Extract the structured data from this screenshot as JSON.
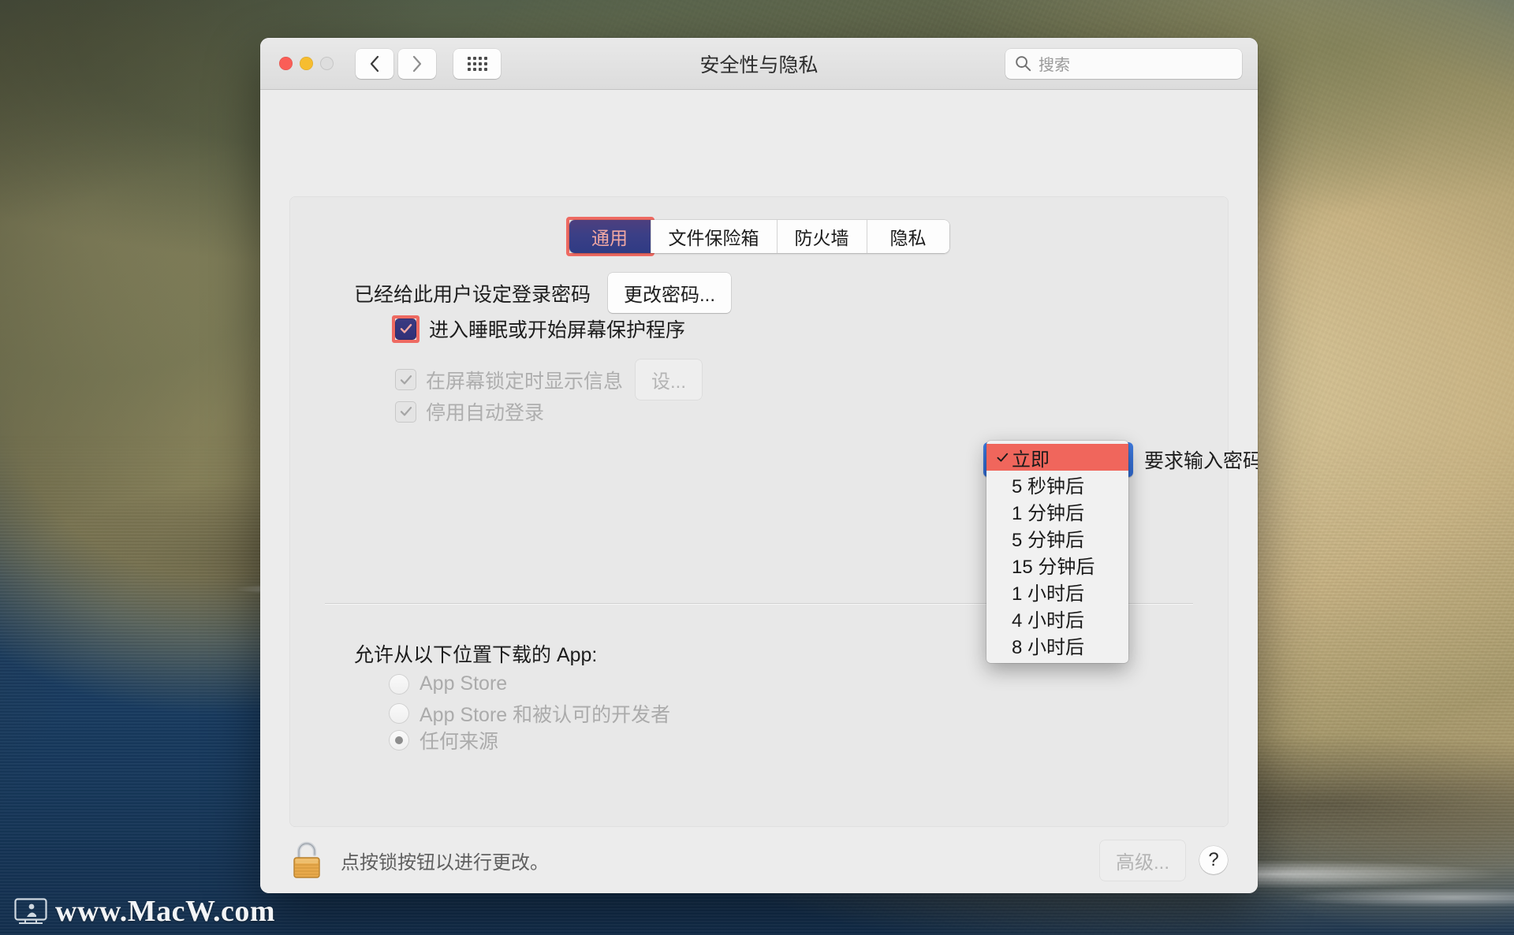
{
  "window": {
    "title": "安全性与隐私",
    "traffic_lights": [
      "close",
      "minimize",
      "zoom"
    ],
    "nav": {
      "back": "back-chevron",
      "forward": "forward-chevron",
      "grid": "show-all-grid"
    }
  },
  "search": {
    "placeholder": "搜索",
    "value": "",
    "icon": "search-icon"
  },
  "tabs": [
    {
      "label": "通用",
      "active": true
    },
    {
      "label": "文件保险箱",
      "active": false
    },
    {
      "label": "防火墙",
      "active": false
    },
    {
      "label": "隐私",
      "active": false
    }
  ],
  "general": {
    "password_row": {
      "label": "已经给此用户设定登录密码",
      "button": "更改密码..."
    },
    "checkboxes": [
      {
        "label": "进入睡眠或开始屏幕保护程序",
        "checked": true,
        "enabled": true,
        "highlighted": true
      },
      {
        "label": "在屏幕锁定时显示信息",
        "checked": true,
        "enabled": false,
        "button": "设..."
      },
      {
        "label": "停用自动登录",
        "checked": true,
        "enabled": false
      }
    ],
    "require_password_suffix": "要求输入密码",
    "popup_value": "立即",
    "dropdown_options": [
      {
        "label": "立即",
        "selected": true
      },
      {
        "label": "5 秒钟后",
        "selected": false
      },
      {
        "label": "1 分钟后",
        "selected": false
      },
      {
        "label": "5 分钟后",
        "selected": false
      },
      {
        "label": "15 分钟后",
        "selected": false
      },
      {
        "label": "1 小时后",
        "selected": false
      },
      {
        "label": "4 小时后",
        "selected": false
      },
      {
        "label": "8 小时后",
        "selected": false
      }
    ]
  },
  "downloads": {
    "title": "允许从以下位置下载的 App:",
    "options": [
      {
        "label": "App Store",
        "selected": false
      },
      {
        "label": "App Store 和被认可的开发者",
        "selected": false
      },
      {
        "label": "任何来源",
        "selected": true
      }
    ]
  },
  "bottom": {
    "lock_icon": "unlocked-padlock-icon",
    "lock_text": "点按锁按钮以进行更改。",
    "advanced_button": "高级...",
    "help_button": "?"
  },
  "watermark": {
    "text": "www.MacW.com",
    "icon": "monitor-icon"
  },
  "colors": {
    "accent_blue": "#2f6ad3",
    "highlight_red": "#ee6a62",
    "menu_selected": "#f0665c",
    "tab_active_start": "#4e3f7e",
    "tab_active_end": "#2f3b84",
    "tab_active_text": "#f3a9a3",
    "window_bg": "#ececec",
    "ocean_blue": "#1d4a74",
    "cliff_tan": "#c9b484",
    "lock_gold": "#e8a94b"
  }
}
